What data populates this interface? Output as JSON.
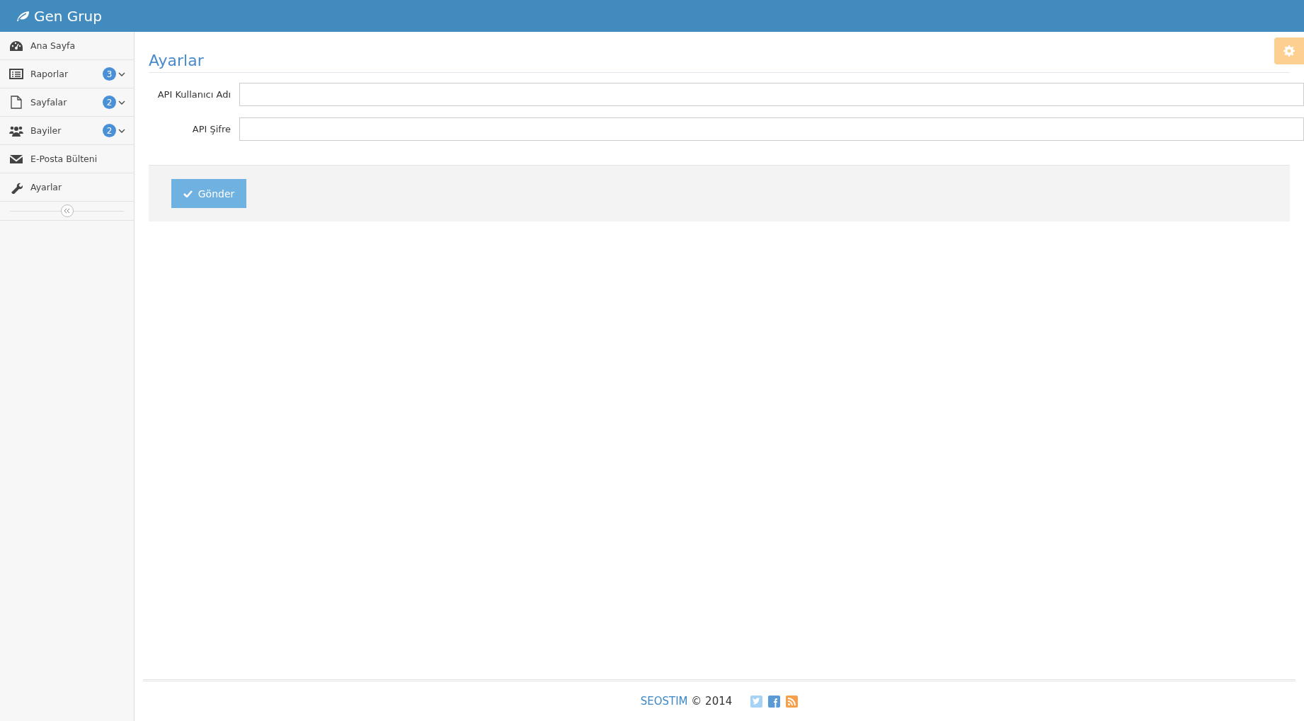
{
  "header": {
    "brand": "Gen Grup"
  },
  "sidebar": {
    "items": [
      {
        "label": "Ana Sayfa",
        "kind": "dashboard",
        "expandable": false
      },
      {
        "label": "Raporlar",
        "kind": "list",
        "badge": "3",
        "expandable": true
      },
      {
        "label": "Sayfalar",
        "kind": "page",
        "badge": "2",
        "expandable": true
      },
      {
        "label": "Bayiler",
        "kind": "users",
        "badge": "2",
        "expandable": true
      },
      {
        "label": "E-Posta Bülteni",
        "kind": "mail",
        "expandable": false
      },
      {
        "label": "Ayarlar",
        "kind": "wrench",
        "expandable": false
      }
    ]
  },
  "page": {
    "title": "Ayarlar",
    "fields": [
      {
        "label": "API Kullanıcı Adı"
      },
      {
        "label": "API Şifre"
      }
    ],
    "submit": "Gönder"
  },
  "footer": {
    "link": "SEOSTIM",
    "text": "© 2014"
  }
}
